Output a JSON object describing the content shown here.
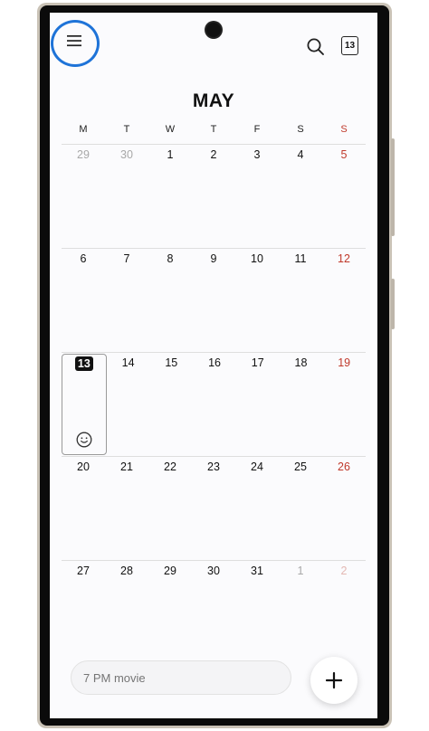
{
  "header": {
    "month": "MAY",
    "today_badge": "13"
  },
  "weekdays": [
    "M",
    "T",
    "W",
    "T",
    "F",
    "S",
    "S"
  ],
  "weeks": [
    [
      {
        "d": "29",
        "other": true
      },
      {
        "d": "30",
        "other": true
      },
      {
        "d": "1"
      },
      {
        "d": "2"
      },
      {
        "d": "3"
      },
      {
        "d": "4"
      },
      {
        "d": "5"
      }
    ],
    [
      {
        "d": "6"
      },
      {
        "d": "7"
      },
      {
        "d": "8"
      },
      {
        "d": "9"
      },
      {
        "d": "10"
      },
      {
        "d": "11"
      },
      {
        "d": "12"
      }
    ],
    [
      {
        "d": "13",
        "today": true
      },
      {
        "d": "14"
      },
      {
        "d": "15"
      },
      {
        "d": "16"
      },
      {
        "d": "17"
      },
      {
        "d": "18"
      },
      {
        "d": "19"
      }
    ],
    [
      {
        "d": "20"
      },
      {
        "d": "21"
      },
      {
        "d": "22"
      },
      {
        "d": "23"
      },
      {
        "d": "24"
      },
      {
        "d": "25"
      },
      {
        "d": "26"
      }
    ],
    [
      {
        "d": "27"
      },
      {
        "d": "28"
      },
      {
        "d": "29"
      },
      {
        "d": "30"
      },
      {
        "d": "31"
      },
      {
        "d": "1",
        "other": true
      },
      {
        "d": "2",
        "other": true
      }
    ]
  ],
  "quick_add": {
    "placeholder": "7 PM movie"
  },
  "icons": {
    "menu": "hamburger-menu-icon",
    "search": "search-icon",
    "today": "calendar-today-icon",
    "add": "plus-icon",
    "sticker": "smiley-icon"
  },
  "colors": {
    "highlight": "#1e73d8",
    "sunday": "#c0392b",
    "accent": "#111111"
  }
}
